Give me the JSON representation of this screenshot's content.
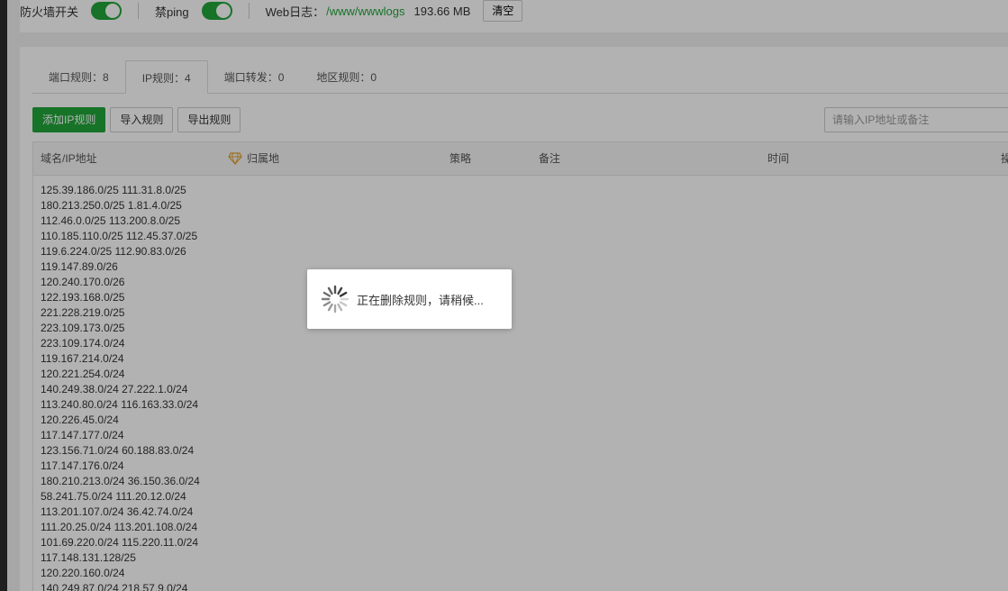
{
  "top_bar": {
    "firewall_label": "防火墙开关",
    "ping_label": "禁ping",
    "weblog_label": "Web日志：",
    "weblog_path": "/www/wwwlogs",
    "weblog_size": "193.66 MB",
    "clear_label": "清空",
    "colors": {
      "accent": "#20a53a"
    }
  },
  "tabs": [
    {
      "label": "端口规则：8",
      "active": false
    },
    {
      "label": "IP规则：4",
      "active": true
    },
    {
      "label": "端口转发：0",
      "active": false
    },
    {
      "label": "地区规则：0",
      "active": false
    }
  ],
  "toolbar": {
    "add_label": "添加IP规则",
    "import_label": "导入规则",
    "export_label": "导出规则",
    "search_placeholder": "请输入IP地址或备注"
  },
  "table": {
    "headers": [
      "域名/IP地址",
      "归属地",
      "策略",
      "备注",
      "时间",
      "操"
    ],
    "ip_lines": [
      "125.39.186.0/25 111.31.8.0/25",
      "180.213.250.0/25 1.81.4.0/25",
      "112.46.0.0/25 113.200.8.0/25",
      "110.185.110.0/25 112.45.37.0/25",
      "119.6.224.0/25 112.90.83.0/26",
      "119.147.89.0/26",
      "120.240.170.0/26",
      "122.193.168.0/25",
      "221.228.219.0/25",
      "223.109.173.0/25",
      "223.109.174.0/24",
      "119.167.214.0/24",
      "120.221.254.0/24",
      "140.249.38.0/24 27.222.1.0/24",
      "113.240.80.0/24 116.163.33.0/24",
      "120.226.45.0/24",
      "117.147.177.0/24",
      "123.156.71.0/24 60.188.83.0/24",
      "117.147.176.0/24",
      "180.210.213.0/24 36.150.36.0/24",
      "58.241.75.0/24 111.20.12.0/24",
      "113.201.107.0/24 36.42.74.0/24",
      "111.20.25.0/24 113.201.108.0/24",
      "101.69.220.0/24 115.220.11.0/24",
      "117.148.131.128/25",
      "120.220.160.0/24",
      "140.249.87.0/24 218.57.9.0/24"
    ]
  },
  "loading": {
    "message": "正在删除规则，请稍候..."
  }
}
